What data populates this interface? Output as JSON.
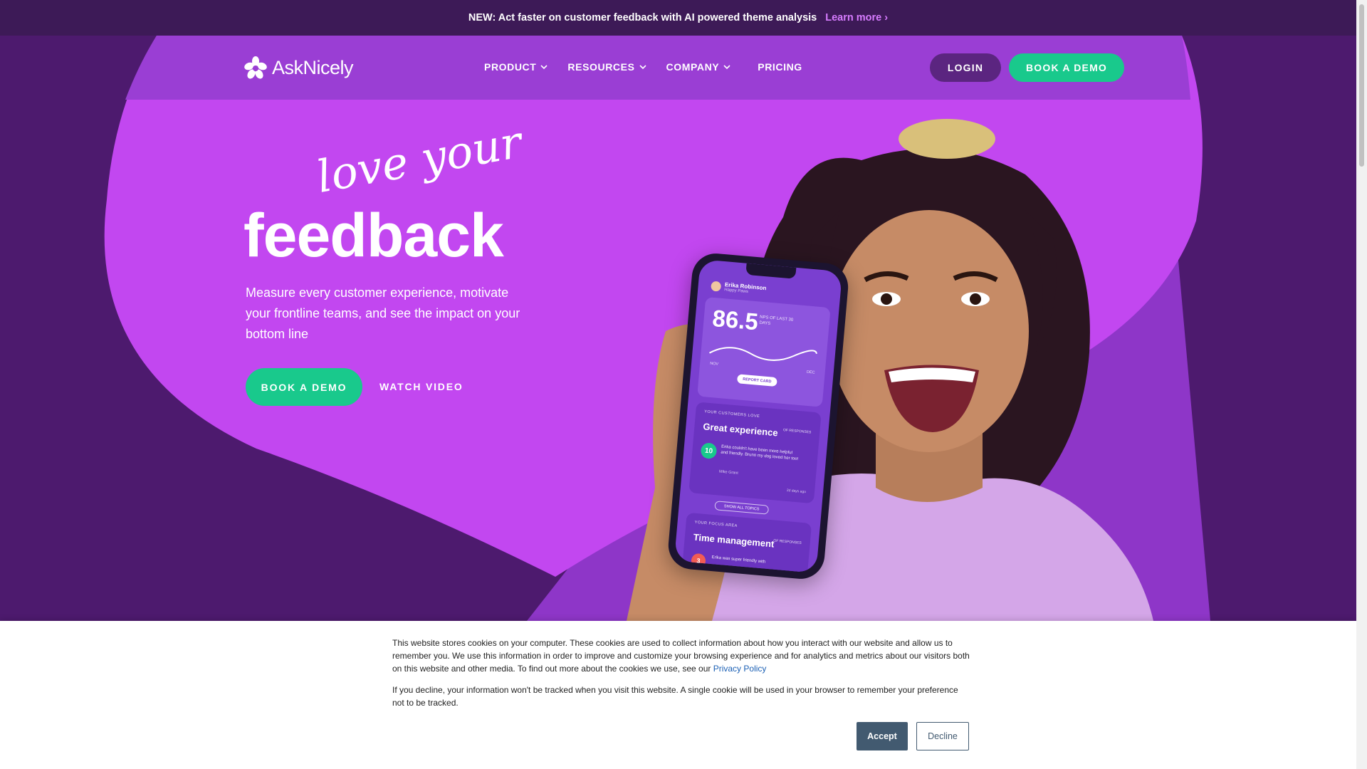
{
  "announcement": {
    "text": "NEW: Act faster on customer feedback with AI powered theme analysis",
    "link": "Learn more",
    "link_chevron": "›"
  },
  "brand": {
    "name": "AskNicely"
  },
  "nav": {
    "items": [
      {
        "label": "PRODUCT",
        "dropdown": true
      },
      {
        "label": "RESOURCES",
        "dropdown": true
      },
      {
        "label": "COMPANY",
        "dropdown": true
      },
      {
        "label": "PRICING",
        "dropdown": false
      }
    ],
    "login": "LOGIN",
    "book_demo": "BOOK A DEMO"
  },
  "hero": {
    "script": "love your",
    "headline": "feedback",
    "subtext": "Measure every customer experience, motivate your frontline teams, and see the impact on your bottom line",
    "cta_primary": "BOOK A DEMO",
    "cta_secondary": "WATCH VIDEO"
  },
  "phone": {
    "user_name": "Erika Robinson",
    "user_sub": "Happy Paws",
    "nps_value": "86.5",
    "nps_label": "NPS OF LAST 30 DAYS",
    "month_start": "NOV",
    "month_end": "DEC",
    "report_btn": "REPORT CARD",
    "love_caption": "YOUR CUSTOMERS LOVE",
    "love_title": "Great experience",
    "love_responses": "OF RESPONSES",
    "love_score": "10",
    "love_quote": "Erika couldn't have been more helpful and friendly. Bruno my dog loved her too!",
    "love_author": "Mike Grant",
    "love_ago": "2d days ago",
    "show_all": "SHOW ALL TOPICS",
    "focus_caption": "YOUR FOCUS AREA",
    "focus_title": "Time management",
    "focus_responses": "OF RESPONSES",
    "focus_score": "3",
    "focus_quote": "Erika was super friendly with"
  },
  "cookie": {
    "p1_text": "This website stores cookies on your computer. These cookies are used to collect information about how you interact with our website and allow us to remember you. We use this information in order to improve and customize your browsing experience and for analytics and metrics about our visitors both on this website and other media. To find out more about the cookies we use, see our ",
    "privacy_link": "Privacy Policy",
    "p2_text": "If you decline, your information won't be tracked when you visit this website. A single cookie will be used in your browser to remember your preference not to be tracked.",
    "accept": "Accept",
    "decline": "Decline"
  },
  "colors": {
    "announce_bg": "#3d1a57",
    "hero_deep": "#4d1a6e",
    "hero_mid": "#9a3ed4",
    "hero_bright": "#c247f0",
    "accent_green": "#19c98c",
    "link_purple": "#d77cff"
  }
}
